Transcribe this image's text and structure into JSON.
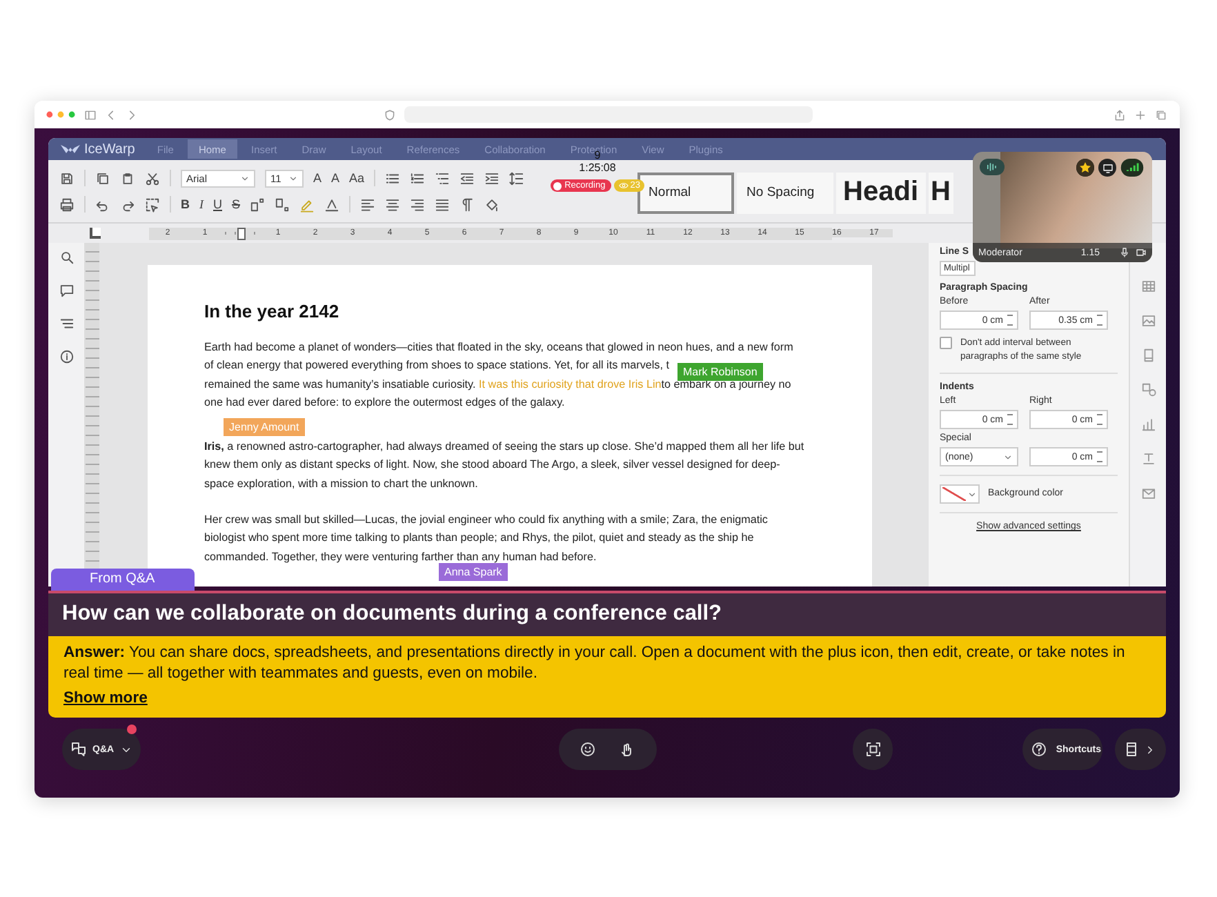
{
  "menu": [
    {
      "label": "File",
      "selected": false
    },
    {
      "label": "Home",
      "selected": true
    },
    {
      "label": "Insert",
      "selected": false
    },
    {
      "label": "Draw",
      "selected": false
    },
    {
      "label": "Layout",
      "selected": false
    },
    {
      "label": "References",
      "selected": false
    },
    {
      "label": "Collaboration",
      "selected": false
    },
    {
      "label": "Protection",
      "selected": false
    },
    {
      "label": "View",
      "selected": false
    },
    {
      "label": "Plugins",
      "selected": false
    }
  ],
  "brand": "IceWarp",
  "call": {
    "count": "9",
    "timer": "1:25:08",
    "recording": "Recording",
    "viewers": "23"
  },
  "toolbar": {
    "font": "Arial",
    "size": "11",
    "font_buttons": [
      "A",
      "A",
      "Aa"
    ],
    "format_buttons": [
      "B",
      "I",
      "U",
      "S"
    ],
    "styles": [
      {
        "label": "Normal",
        "selected": true
      },
      {
        "label": "No Spacing",
        "selected": false
      },
      {
        "label": "Headi",
        "selected": false
      },
      {
        "label": "H",
        "selected": false
      }
    ]
  },
  "ruler": [
    "2",
    "1",
    "1",
    "2",
    "3",
    "4",
    "5",
    "6",
    "7",
    "8",
    "9",
    "10",
    "11",
    "12",
    "13",
    "14",
    "15",
    "16",
    "17"
  ],
  "document": {
    "heading": "In the year 2142",
    "paragraphs": [
      {
        "lines": [
          [
            {
              "kind": "text",
              "text": "Earth had become a planet of wonders—cities that floated in the sky, oceans that glowed in neon hues, and a new form"
            }
          ],
          [
            {
              "kind": "text",
              "text": "of clean energy that powered everything from shoes to space stations. Yet, for all its marvels, t"
            }
          ],
          [
            {
              "kind": "text",
              "text": "remained the same was humanity’s insatiable curiosity. "
            },
            {
              "kind": "highlight",
              "text": "It was this curiosity that drove Iris Lin"
            },
            {
              "kind": "text",
              "text": "to embark on a journey no"
            }
          ],
          [
            {
              "kind": "text",
              "text": "one had ever dared before: to explore the outermost edges of the galaxy."
            }
          ]
        ]
      },
      {
        "lines": [
          [
            {
              "kind": "bold",
              "text": "Iris,"
            },
            {
              "kind": "text",
              "text": " a renowned astro-cartographer, had always dreamed of seeing the stars up close. She’d mapped them all her life but"
            }
          ],
          [
            {
              "kind": "text",
              "text": "knew them only as distant specks of light. Now, she stood aboard The Argo, a sleek, silver vessel designed for deep-"
            }
          ],
          [
            {
              "kind": "text",
              "text": "space exploration, with a mission to chart the unknown."
            }
          ]
        ]
      },
      {
        "lines": [
          [
            {
              "kind": "text",
              "text": "Her crew was small but skilled—Lucas, the jovial engineer who could fix anything with a smile; Zara, the enigmatic"
            }
          ],
          [
            {
              "kind": "text",
              "text": "biologist who spent more time talking to plants than people; and Rhys, the pilot, quiet and steady as the ship he"
            }
          ],
          [
            {
              "kind": "text",
              "text": "commanded. Together, they were venturing farther than any human had before."
            }
          ]
        ]
      }
    ],
    "cursors": [
      {
        "name": "Mark Robinson",
        "color": "#3ea52f"
      },
      {
        "name": "Jenny Amount",
        "color": "#f2a65a"
      },
      {
        "name": "Anna Spark",
        "color": "#9a6bd8"
      }
    ]
  },
  "video": {
    "role": "Moderator",
    "spacing": "1.15"
  },
  "panel": {
    "line_spacing_label": "Line S",
    "line_spacing_type": "Multipl",
    "para_title": "Paragraph Spacing",
    "before_label": "Before",
    "before": "0 cm",
    "after_label": "After",
    "after": "0.35 cm",
    "no_interval": {
      "label": "Don't add interval between paragraphs of the same style",
      "checked": false
    },
    "indents_title": "Indents",
    "left_label": "Left",
    "left": "0 cm",
    "right_label": "Right",
    "right": "0 cm",
    "special_label": "Special",
    "special": "(none)",
    "special_value": "0 cm",
    "bg_label": "Background color",
    "advanced": "Show advanced settings"
  },
  "qa": {
    "tab": "From Q&A",
    "question": "How can we collaborate on documents during a conference call?",
    "answer": "**Answer:** You can share docs, spreadsheets, and presentations directly in your call. Open a document with the plus icon, then edit, create, or take notes in real time — all together with teammates and guests, even on mobile.",
    "more": "Show more"
  },
  "controls": {
    "qa_label": "Q&A",
    "qa_notification": true,
    "shortcuts": "Shortcuts"
  }
}
